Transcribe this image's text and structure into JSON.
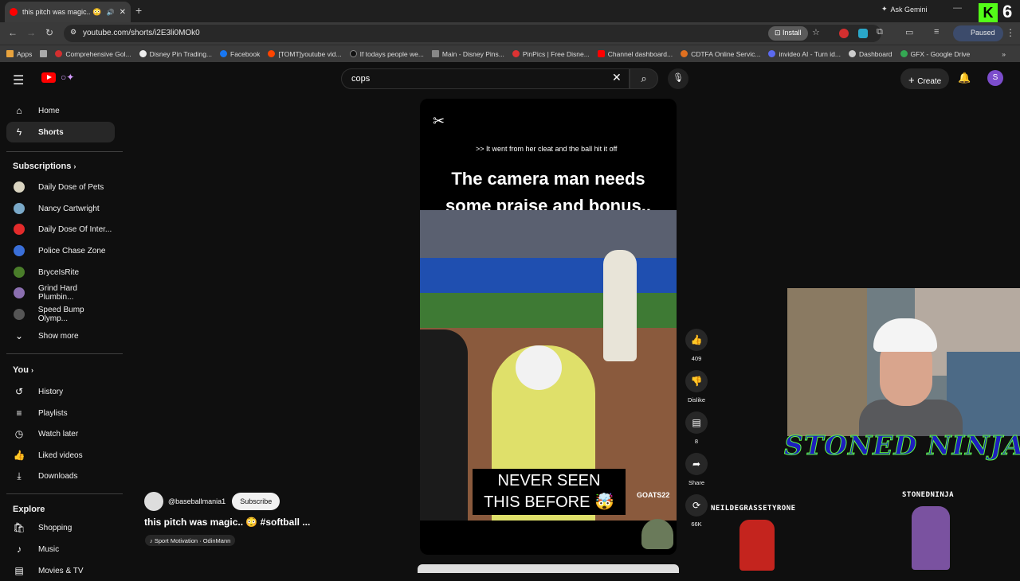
{
  "browser": {
    "tab_title": "this pitch was magic.. 😳 #...",
    "ask_gemini": "Ask Gemini",
    "url": "youtube.com/shorts/i2E3li0MOk0",
    "install": "Install",
    "profile_status": "Paused",
    "bookmarks": [
      "Apps",
      "Comprehensive Gol...",
      "Disney Pin Trading...",
      "Facebook",
      "[TOMT]youtube vid...",
      "If todays people we...",
      "Main - Disney Pins...",
      "PinPics | Free Disne...",
      "Channel dashboard...",
      "CDTFA Online Servic...",
      "invideo AI - Turn id...",
      "Dashboard",
      "GFX - Google Drive"
    ],
    "overlay_number": "6"
  },
  "header": {
    "search_value": "cops",
    "create_label": "Create",
    "avatar_letter": "S"
  },
  "sidebar": {
    "main": [
      {
        "label": "Home",
        "icon": "home-icon"
      },
      {
        "label": "Shorts",
        "icon": "shorts-icon"
      }
    ],
    "subscriptions_heading": "Subscriptions",
    "subscriptions": [
      {
        "label": "Daily Dose of Pets",
        "color": "#d9d4c0"
      },
      {
        "label": "Nancy Cartwright",
        "color": "#7aa9c8"
      },
      {
        "label": "Daily Dose Of Inter...",
        "color": "#e32b2b"
      },
      {
        "label": "Police Chase Zone",
        "color": "#3a6fd8"
      },
      {
        "label": "BryceIsRite",
        "color": "#4a7d2a"
      },
      {
        "label": "Grind Hard Plumbin...",
        "color": "#8b6fb0"
      },
      {
        "label": "Speed Bump Olymp...",
        "color": "#555555"
      }
    ],
    "show_more": "Show more",
    "you_heading": "You",
    "you_items": [
      {
        "label": "History"
      },
      {
        "label": "Playlists"
      },
      {
        "label": "Watch later"
      },
      {
        "label": "Liked videos"
      },
      {
        "label": "Downloads"
      }
    ],
    "explore_heading": "Explore",
    "explore_items": [
      {
        "label": "Shopping"
      },
      {
        "label": "Music"
      },
      {
        "label": "Movies & TV"
      }
    ]
  },
  "video": {
    "caption": ">> It went from her cleat and the ball hit it off",
    "overlay_line1": "The camera man needs",
    "overlay_line2": "some praise and bonus..",
    "bottom_line1": "NEVER SEEN",
    "bottom_line2": "THIS BEFORE 🤯",
    "watermark": "GOATS22"
  },
  "actions": {
    "likes": "409",
    "dislike": "Dislike",
    "comments": "8",
    "share": "Share",
    "remix": "66K"
  },
  "channel": {
    "handle": "@baseballmania1",
    "subscribe": "Subscribe",
    "title": "this pitch was magic.. 😳 #softball ...",
    "music": "Sport Motivation · OdinMann"
  },
  "stream_overlay": {
    "ninja_text": "STONED NINJA",
    "sprite1_label": "NEILDEGRASSETYRONE",
    "sprite2_label": "STONEDNINJA"
  }
}
